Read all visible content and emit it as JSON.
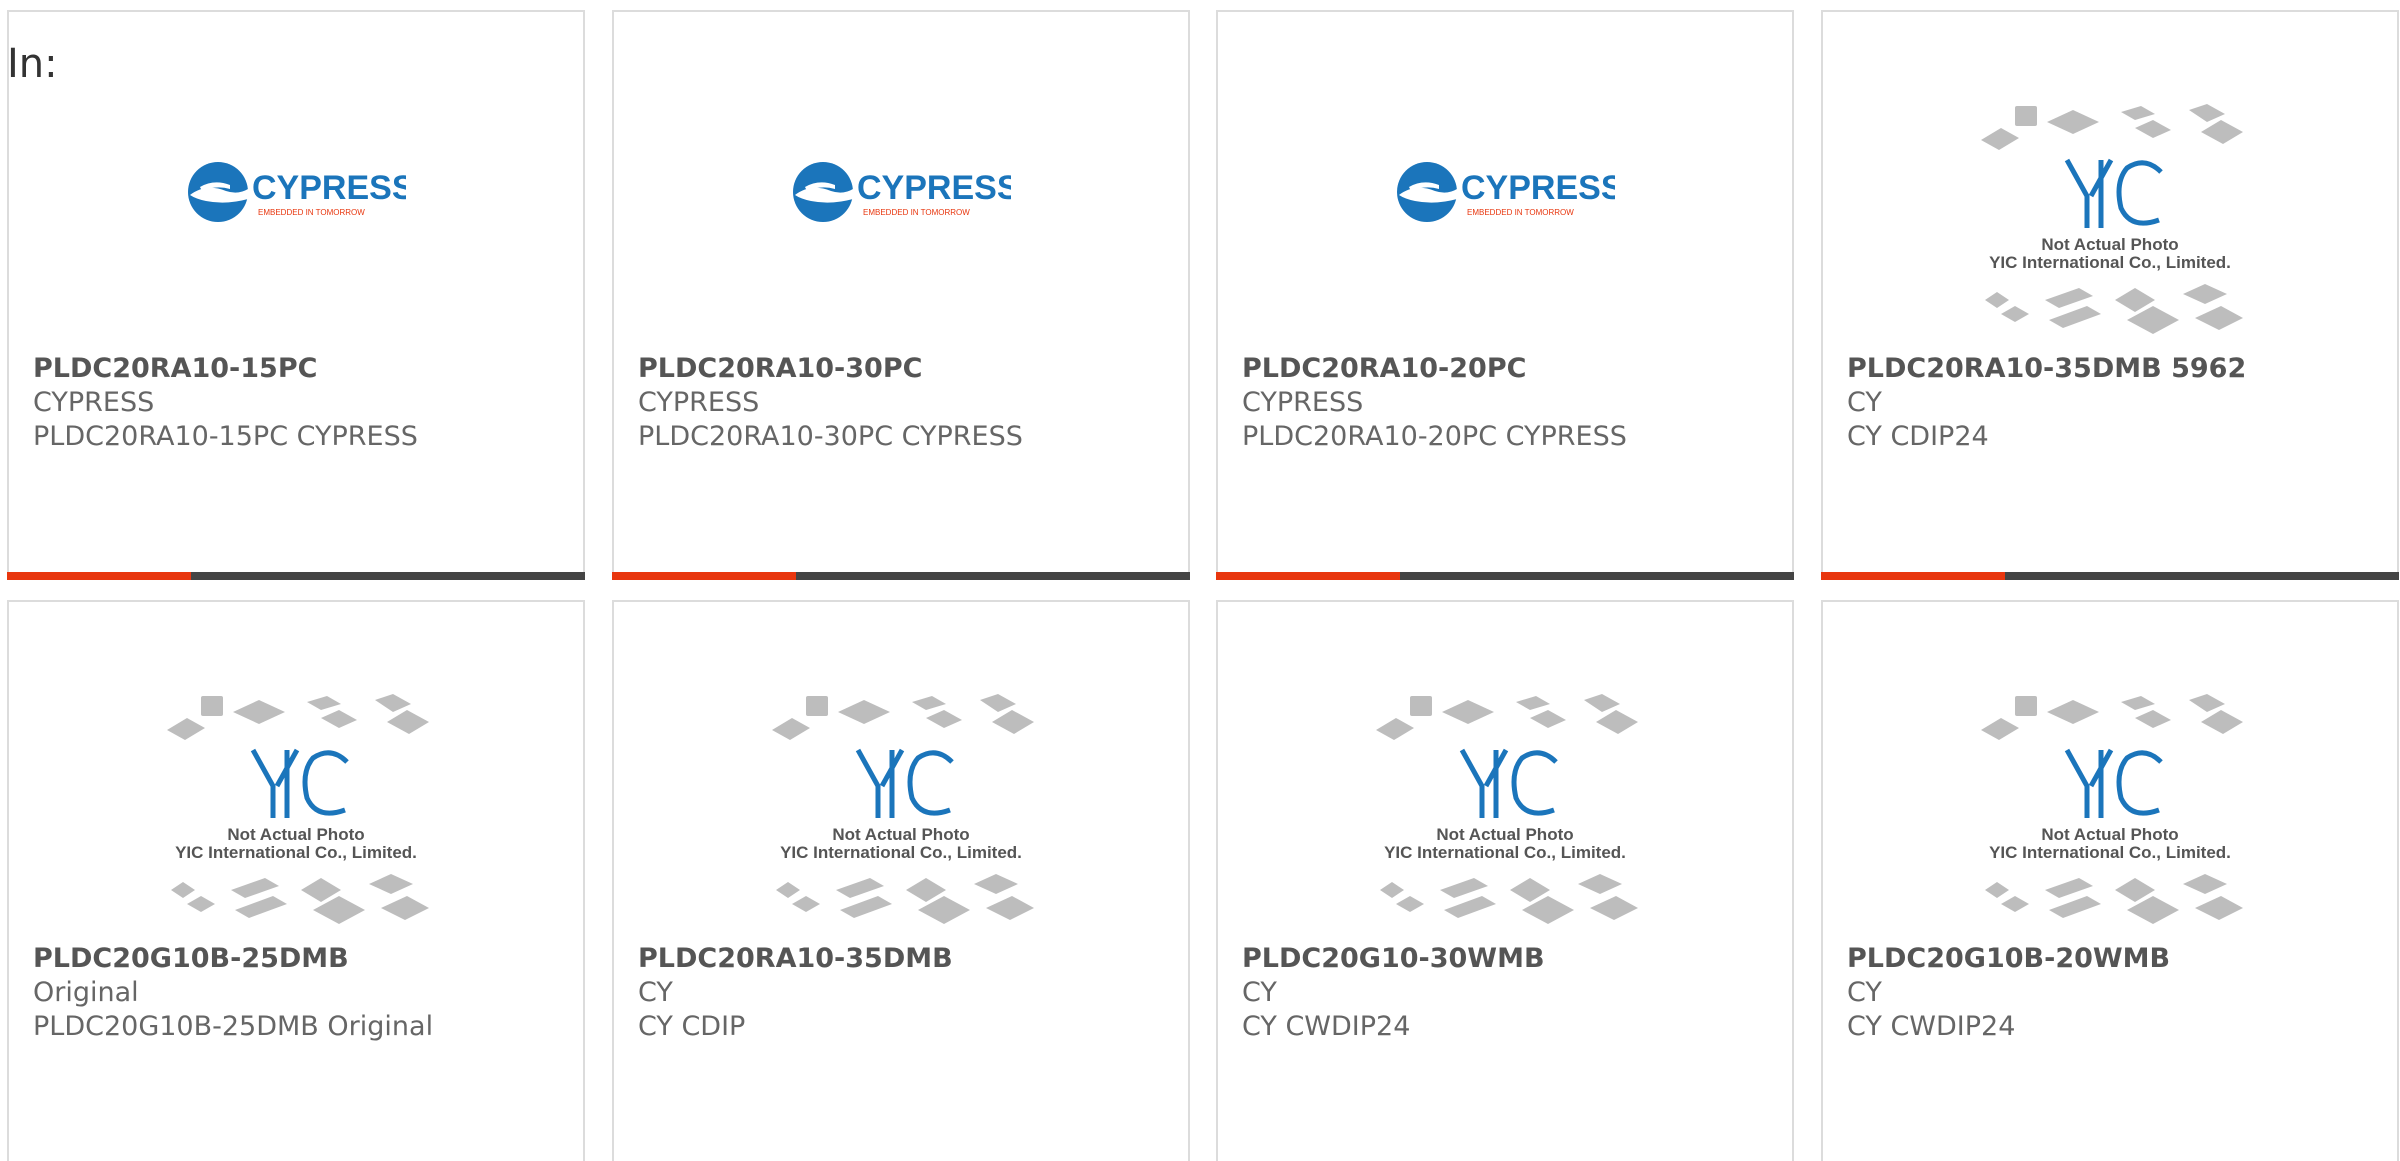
{
  "header": {
    "in_label": "In:"
  },
  "colors": {
    "accent": "#e8360e",
    "bar": "#444444",
    "border": "#dcdcdc",
    "cypress_blue": "#1b75bb",
    "text": "#666666"
  },
  "logos": {
    "cypress": {
      "name": "CYPRESS",
      "tagline": "EMBEDDED IN TOMORROW"
    },
    "yic": {
      "mark": "YIC",
      "line1": "Not Actual Photo",
      "line2": "YIC International Co., Limited."
    }
  },
  "products": [
    {
      "part": "PLDC20RA10-15PC",
      "brand": "CYPRESS",
      "desc": "PLDC20RA10-15PC CYPRESS",
      "image": "cypress-logo",
      "bar": true
    },
    {
      "part": "PLDC20RA10-30PC",
      "brand": "CYPRESS",
      "desc": "PLDC20RA10-30PC CYPRESS",
      "image": "cypress-logo",
      "bar": true
    },
    {
      "part": "PLDC20RA10-20PC",
      "brand": "CYPRESS",
      "desc": "PLDC20RA10-20PC CYPRESS",
      "image": "cypress-logo",
      "bar": true
    },
    {
      "part": "PLDC20RA10-35DMB 5962",
      "brand": "CY",
      "desc": "CY CDIP24",
      "image": "yic-placeholder",
      "bar": true
    },
    {
      "part": "PLDC20G10B-25DMB",
      "brand": "Original",
      "desc": "PLDC20G10B-25DMB Original",
      "image": "yic-placeholder",
      "bar": false
    },
    {
      "part": "PLDC20RA10-35DMB",
      "brand": "CY",
      "desc": "CY CDIP",
      "image": "yic-placeholder",
      "bar": false
    },
    {
      "part": "PLDC20G10-30WMB",
      "brand": "CY",
      "desc": "CY CWDIP24",
      "image": "yic-placeholder",
      "bar": false
    },
    {
      "part": "PLDC20G10B-20WMB",
      "brand": "CY",
      "desc": "CY CWDIP24",
      "image": "yic-placeholder",
      "bar": false
    }
  ]
}
